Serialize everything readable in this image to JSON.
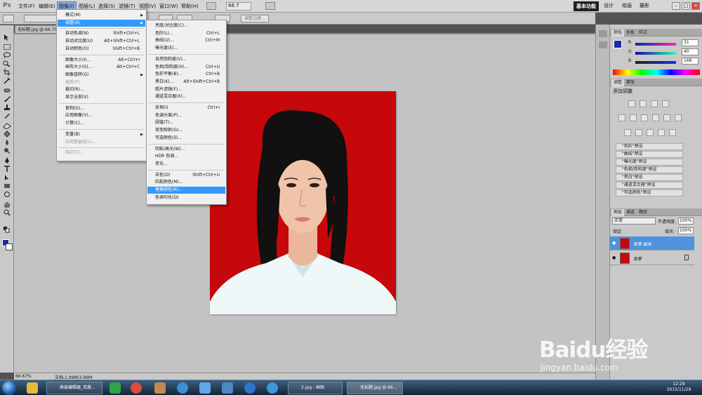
{
  "app": {
    "logo": "Ps"
  },
  "menubar": {
    "items": [
      "文件(F)",
      "编辑(E)",
      "图像(I)",
      "图层(L)",
      "选择(S)",
      "滤镜(T)",
      "视图(V)",
      "窗口(W)",
      "帮助(H)"
    ],
    "zoom": "66.7",
    "workspaces": [
      "基本功能",
      "设计",
      "绘画",
      "摄影"
    ],
    "active_workspace": "基本功能"
  },
  "options": {
    "refine_edge": "调整边缘..."
  },
  "document": {
    "tab": "无标题.jpg @ 66.7%"
  },
  "menu_image": {
    "items": [
      {
        "label": "模式(M)",
        "shortcut": "",
        "submenu": true
      },
      {
        "label": "调整(A)",
        "shortcut": "",
        "submenu": true,
        "highlighted": true
      },
      {
        "label": "自动色调(N)",
        "shortcut": "Shift+Ctrl+L"
      },
      {
        "label": "自动对比度(U)",
        "shortcut": "Alt+Shift+Ctrl+L"
      },
      {
        "label": "自动颜色(O)",
        "shortcut": "Shift+Ctrl+B"
      },
      {
        "label": "图像大小(I)...",
        "shortcut": "Alt+Ctrl+I"
      },
      {
        "label": "画布大小(S)...",
        "shortcut": "Alt+Ctrl+C"
      },
      {
        "label": "图像旋转(G)",
        "shortcut": "",
        "submenu": true
      },
      {
        "label": "裁剪(P)",
        "shortcut": "",
        "disabled": true
      },
      {
        "label": "裁切(R)...",
        "shortcut": ""
      },
      {
        "label": "显示全部(V)",
        "shortcut": ""
      },
      {
        "label": "复制(D)...",
        "shortcut": ""
      },
      {
        "label": "应用图像(Y)...",
        "shortcut": ""
      },
      {
        "label": "计算(C)...",
        "shortcut": ""
      },
      {
        "label": "变量(B)",
        "shortcut": "",
        "submenu": true
      },
      {
        "label": "应用数据组(L)...",
        "shortcut": "",
        "disabled": true
      },
      {
        "label": "陷印(T)...",
        "shortcut": "",
        "disabled": true
      }
    ]
  },
  "menu_adjust": {
    "items": [
      {
        "label": "亮度/对比度(C)...",
        "shortcut": ""
      },
      {
        "label": "色阶(L)...",
        "shortcut": "Ctrl+L"
      },
      {
        "label": "曲线(U)...",
        "shortcut": "Ctrl+M"
      },
      {
        "label": "曝光度(E)...",
        "shortcut": ""
      },
      {
        "label": "自然饱和度(V)...",
        "shortcut": ""
      },
      {
        "label": "色相/饱和度(H)...",
        "shortcut": "Ctrl+U"
      },
      {
        "label": "色彩平衡(B)...",
        "shortcut": "Ctrl+B"
      },
      {
        "label": "黑白(K)...",
        "shortcut": "Alt+Shift+Ctrl+B"
      },
      {
        "label": "照片滤镜(F)...",
        "shortcut": ""
      },
      {
        "label": "通道混合器(X)...",
        "shortcut": ""
      },
      {
        "label": "反相(I)",
        "shortcut": "Ctrl+I"
      },
      {
        "label": "色调分离(P)...",
        "shortcut": ""
      },
      {
        "label": "阈值(T)...",
        "shortcut": ""
      },
      {
        "label": "渐变映射(G)...",
        "shortcut": ""
      },
      {
        "label": "可选颜色(S)...",
        "shortcut": ""
      },
      {
        "label": "阴影/高光(W)...",
        "shortcut": ""
      },
      {
        "label": "HDR 色调...",
        "shortcut": ""
      },
      {
        "label": "变化...",
        "shortcut": ""
      },
      {
        "label": "去色(D)",
        "shortcut": "Shift+Ctrl+U"
      },
      {
        "label": "匹配颜色(M)...",
        "shortcut": ""
      },
      {
        "label": "替换颜色(R)...",
        "shortcut": "",
        "highlighted": true
      },
      {
        "label": "色调均化(Q)",
        "shortcut": ""
      }
    ]
  },
  "color_panel": {
    "tabs": [
      "颜色",
      "色板",
      "样式"
    ],
    "r": "31",
    "g": "40",
    "b": "168",
    "r_label": "R",
    "g_label": "G",
    "b_label": "B",
    "foreground": "#1f28a8"
  },
  "adjust_panel": {
    "tabs": [
      "调整",
      "蒙版"
    ],
    "title": "添加调整",
    "presets": [
      "\"色阶\"预设",
      "\"曲线\"预设",
      "\"曝光度\"预设",
      "\"色相/饱和度\"预设",
      "\"黑白\"预设",
      "\"通道混合器\"预设",
      "\"可选颜色\"预设"
    ]
  },
  "layers_panel": {
    "tabs": [
      "图层",
      "通道",
      "路径"
    ],
    "blend_mode": "正常",
    "opacity_label": "不透明度:",
    "opacity": "100%",
    "lock_label": "锁定:",
    "fill_label": "填充:",
    "fill": "100%",
    "layers": [
      {
        "name": "背景 副本",
        "selected": true
      },
      {
        "name": "背景",
        "selected": false
      }
    ]
  },
  "status": {
    "zoom": "66.67%",
    "doc": "文档:1.99M/3.99M"
  },
  "watermark": {
    "text": "Baidu经验",
    "url": "jingyan.baidu.com"
  },
  "taskbar": {
    "tasks": [
      "高级编辑器_百度...",
      "2.jpg - 画图",
      "无标题.jpg @ 66..."
    ],
    "time": "12:29",
    "date": "2015/11/29"
  }
}
